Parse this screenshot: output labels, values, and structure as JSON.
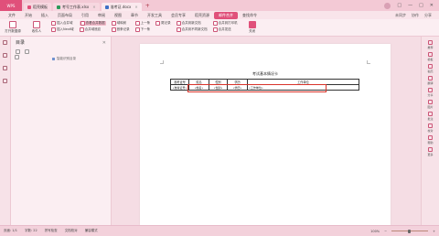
{
  "titlebar": {
    "logo_label": "WPS",
    "tabs": [
      {
        "label": "稻壳模板",
        "color": "#e0507a",
        "active": false
      },
      {
        "label": "考号工作表.xlsx",
        "color": "#2b9a59",
        "active": false
      },
      {
        "label": "准考证.docx",
        "color": "#3d6fc6",
        "active": true
      }
    ],
    "add_tab": "+",
    "window_controls": [
      "□",
      "—",
      "□",
      "✕"
    ]
  },
  "menubar": {
    "items": [
      "文件",
      "开始",
      "插入",
      "页面布局",
      "引用",
      "审阅",
      "视图",
      "章节",
      "开发工具",
      "会员专享",
      "稻壳资源",
      "邮件合并",
      "查找命令"
    ],
    "active_index": 11,
    "right_items": [
      "未同步",
      "协作",
      "分享"
    ]
  },
  "ribbon": {
    "big_buttons": [
      "打开数据源",
      "收件人"
    ],
    "col1": [
      "插入合并域",
      "插入Next域",
      "查看合并数据"
    ],
    "col2": [
      "合并域底纹",
      "域映射",
      "首条记录"
    ],
    "nav": [
      "上一条",
      "下一条",
      "尾记录"
    ],
    "col3": [
      "合并到新文档",
      "合并到不同新文档",
      "合并到打印机",
      "合并发送"
    ],
    "close": "关闭"
  },
  "nav_pane": {
    "title": "目录",
    "close": "✕",
    "entry": "智能识别目录"
  },
  "document": {
    "title": "考试基本情况卡",
    "headers": [
      "准考证号",
      "姓名",
      "性别",
      "学历",
      "工作单位"
    ],
    "fields": [
      "«准考证号»",
      "«姓名»",
      "«性别»",
      "«学历»",
      "«工作单位»"
    ]
  },
  "right_strip": [
    "推荐",
    "模板",
    "稻壳",
    "翻译",
    "分享",
    "图片",
    "批注",
    "校对",
    "帮助",
    "更多"
  ],
  "statusbar": {
    "page": "页面: 1/1",
    "words": "字数: 22",
    "spell": "拼写检查",
    "doc_check": "文档校对",
    "compat": "兼容模式",
    "zoom": "100%"
  },
  "colors": {
    "accent": "#e0507a",
    "highlight_box": "#d9342b"
  }
}
